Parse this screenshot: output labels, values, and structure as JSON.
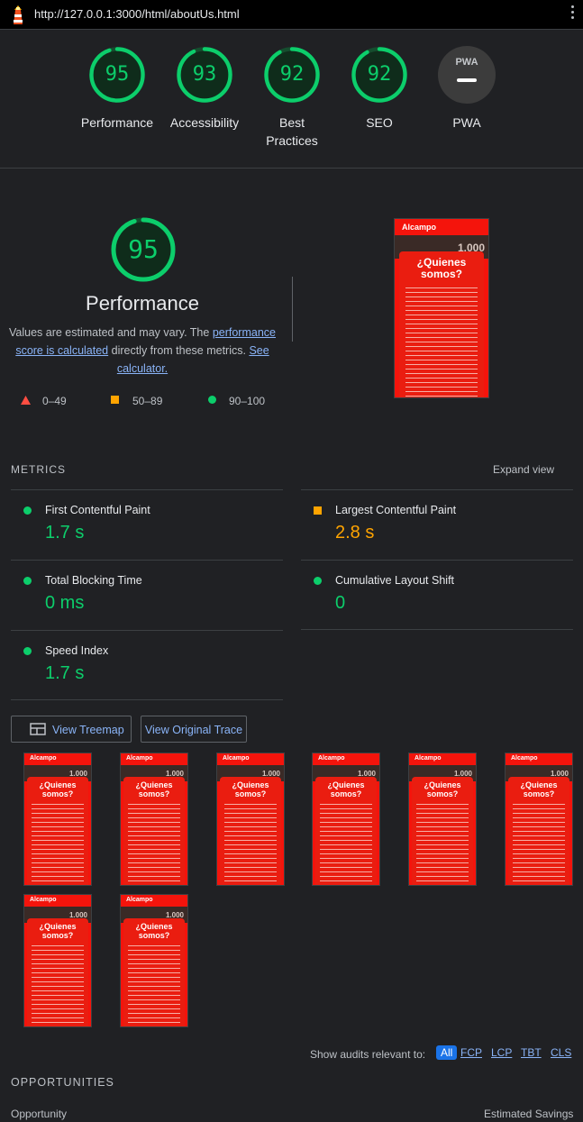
{
  "browser": {
    "url": "http://127.0.0.1:3000/html/aboutUs.html"
  },
  "gauges": [
    {
      "label": "Performance",
      "score": "95",
      "fraction": 0.95
    },
    {
      "label": "Accessibility",
      "score": "93",
      "fraction": 0.93
    },
    {
      "label": "Best Practices",
      "score": "92",
      "fraction": 0.92
    },
    {
      "label": "SEO",
      "score": "92",
      "fraction": 0.92
    },
    {
      "label": "PWA",
      "score": "PWA",
      "fraction": 0
    }
  ],
  "performance": {
    "score": "95",
    "title": "Performance",
    "desc_pre": "Values are estimated and may vary. The ",
    "desc_link1": "performance score is calculated",
    "desc_mid": " directly from these metrics. ",
    "desc_link2": "See calculator.",
    "legend": [
      "0–49",
      "50–89",
      "90–100"
    ]
  },
  "screenshot": {
    "brand": "Alcampo",
    "hero_text": "1.000",
    "heading": "¿Quienes somos?"
  },
  "metrics": {
    "title": "METRICS",
    "expand": "Expand view",
    "items": [
      {
        "label": "First Contentful Paint",
        "value": "1.7 s",
        "status": "pass"
      },
      {
        "label": "Largest Contentful Paint",
        "value": "2.8 s",
        "status": "average"
      },
      {
        "label": "Total Blocking Time",
        "value": "0 ms",
        "status": "pass"
      },
      {
        "label": "Cumulative Layout Shift",
        "value": "0",
        "status": "pass"
      },
      {
        "label": "Speed Index",
        "value": "1.7 s",
        "status": "pass"
      }
    ]
  },
  "buttons": {
    "treemap": "View Treemap",
    "trace": "View Original Trace"
  },
  "filmstrip_count": 8,
  "audit_filter": {
    "label": "Show audits relevant to:",
    "options": [
      "All",
      "FCP",
      "LCP",
      "TBT",
      "CLS"
    ],
    "selected": "All"
  },
  "opportunities": {
    "title": "OPPORTUNITIES",
    "col_left": "Opportunity",
    "col_right": "Estimated Savings"
  },
  "colors": {
    "pass": "#0cce6b",
    "average": "#ffa400",
    "fail": "#ff4e42",
    "link": "#8ab4f8"
  }
}
